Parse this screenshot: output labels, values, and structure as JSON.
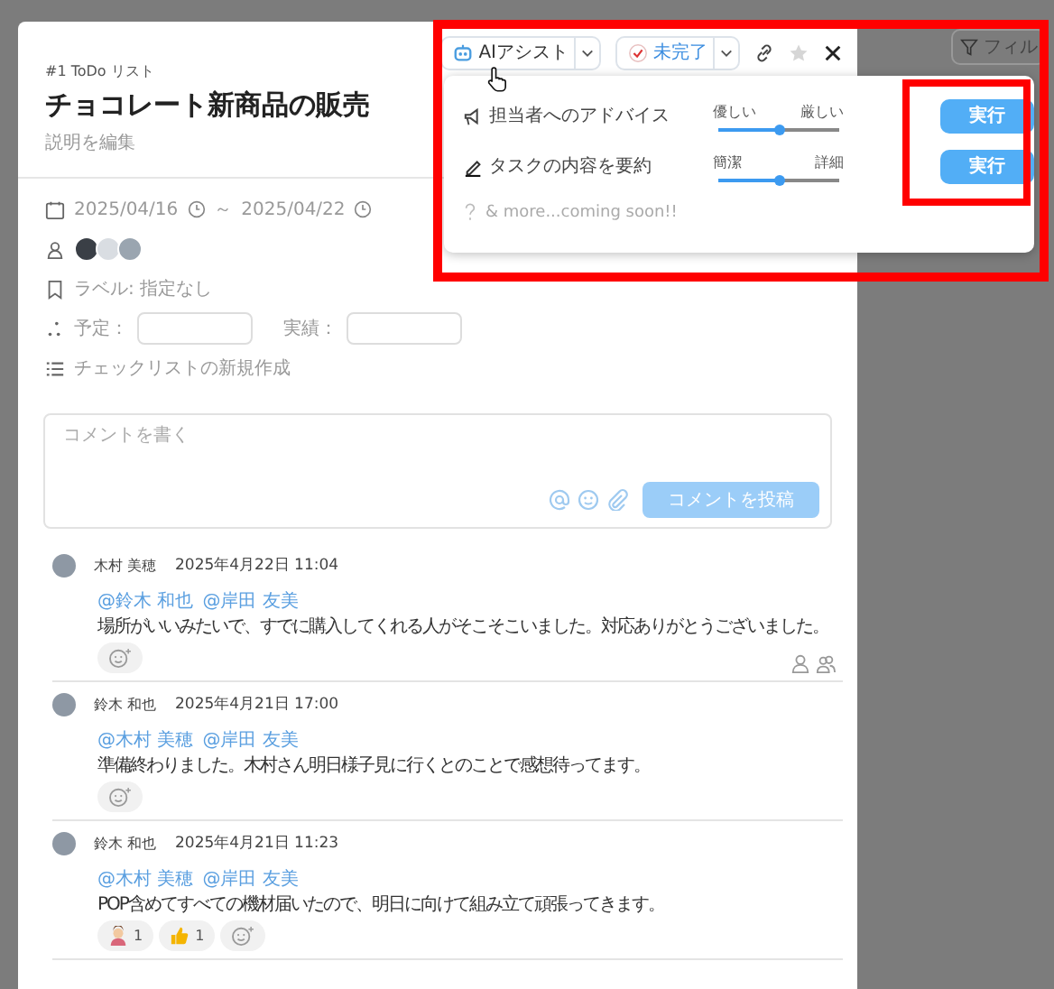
{
  "background": {
    "filter_button": "フィル"
  },
  "task": {
    "list": "#1 ToDo リスト",
    "title": "チョコレート新商品の販売",
    "description_link": "説明を編集",
    "start_date": "2025/04/16",
    "separator": "～",
    "end_date": "2025/04/22",
    "label": "ラベル: 指定なし",
    "planned_label": "予定：",
    "actual_label": "実績：",
    "checklist_link": "チェックリストの新規作成"
  },
  "toolbar": {
    "ai_assist": "AIアシスト",
    "status": "未完了",
    "starred": false
  },
  "assist_menu": {
    "items": [
      {
        "kind": "advice",
        "label": "担当者へのアドバイス",
        "min_label": "優しい",
        "max_label": "厳しい",
        "level": 0.5,
        "run": "実行"
      },
      {
        "kind": "summary",
        "label": "タスクの内容を要約",
        "min_label": "簡潔",
        "max_label": "詳細",
        "level": 0.5,
        "run": "実行"
      }
    ],
    "more": "& more...coming soon!!"
  },
  "comment_box": {
    "placeholder": "コメントを書く",
    "submit": "コメントを投稿",
    "disabled": true
  },
  "comments": [
    {
      "author": "木村 美穂",
      "time": "2025年4月22日 11:04",
      "mentions": [
        "@鈴木 和也",
        "@岸田 友美"
      ],
      "text": "場所がいいみたいで、すでに購入してくれる人がそこそこいました。対応ありがとうございました。",
      "read_icons": true
    },
    {
      "author": "鈴木 和也",
      "time": "2025年4月21日 17:00",
      "mentions": [
        "@木村 美穂",
        "@岸田 友美"
      ],
      "text": "準備終わりました。木村さん明日様子見に行くとのことで感想待ってます。",
      "read_icons": false
    },
    {
      "author": "鈴木 和也",
      "time": "2025年4月21日 11:23",
      "mentions": [
        "@木村 美穂",
        "@岸田 友美"
      ],
      "text": "POP含めてすべての機材届いたので、明日に向けて組み立て頑張ってきます。",
      "reactions": [
        {
          "kind": "person",
          "count": "1"
        },
        {
          "kind": "thumbs_up",
          "count": "1"
        }
      ],
      "read_icons": false
    }
  ]
}
